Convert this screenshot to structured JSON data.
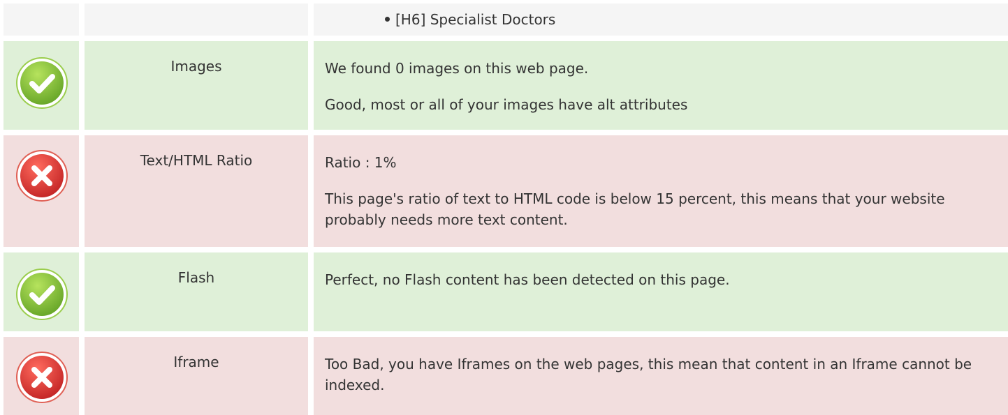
{
  "headings_tail": {
    "item": "[H6] Specialist  Doctors"
  },
  "rows": [
    {
      "label": "Images",
      "status": "pass",
      "icon": "check-circle-icon",
      "lines": [
        "We found 0 images on this web page.",
        "Good, most or all of your images have alt attributes"
      ]
    },
    {
      "label": "Text/HTML Ratio",
      "status": "fail",
      "icon": "cross-circle-icon",
      "lines": [
        "Ratio : 1%",
        "This page's ratio of text to HTML code is below 15 percent, this means that your website probably needs more text content."
      ]
    },
    {
      "label": "Flash",
      "status": "pass",
      "icon": "check-circle-icon",
      "lines": [
        "Perfect, no Flash content has been detected on this page."
      ]
    },
    {
      "label": "Iframe",
      "status": "fail",
      "icon": "cross-circle-icon",
      "lines": [
        "Too Bad, you have Iframes on the web pages, this mean that content in an Iframe cannot be indexed."
      ]
    }
  ],
  "colors": {
    "pass_bg": "#dff0d8",
    "fail_bg": "#f2dede",
    "neutral_bg": "#f5f5f5",
    "pass_icon": "#8cc63f",
    "fail_icon": "#e53935"
  }
}
